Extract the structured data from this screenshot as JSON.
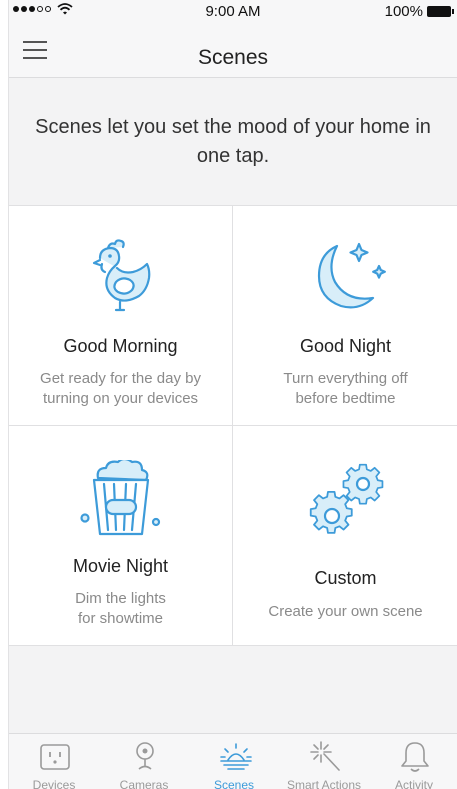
{
  "status_bar": {
    "time": "9:00 AM",
    "battery": "100%"
  },
  "nav": {
    "title": "Scenes",
    "menu_icon": "hamburger-icon"
  },
  "intro": {
    "text": "Scenes let you set the mood of your home in one tap."
  },
  "scenes": [
    {
      "title": "Good Morning",
      "description": "Get ready for the day by\nturning on your devices",
      "icon": "rooster-icon"
    },
    {
      "title": "Good Night",
      "description": "Turn everything off\nbefore bedtime",
      "icon": "moon-stars-icon"
    },
    {
      "title": "Movie Night",
      "description": "Dim the lights\nfor showtime",
      "icon": "popcorn-icon"
    },
    {
      "title": "Custom",
      "description": "Create your own scene",
      "icon": "gears-icon"
    }
  ],
  "tabs": [
    {
      "label": "Devices",
      "icon": "outlet-icon",
      "active": false
    },
    {
      "label": "Cameras",
      "icon": "camera-icon",
      "active": false
    },
    {
      "label": "Scenes",
      "icon": "sunrise-icon",
      "active": true
    },
    {
      "label": "Smart Actions",
      "icon": "magic-wand-icon",
      "active": false
    },
    {
      "label": "Activity",
      "icon": "bell-icon",
      "active": false
    }
  ],
  "colors": {
    "accent": "#3d9bd9",
    "icon_fill": "#d8eef9",
    "muted_text": "#8a8a8a"
  }
}
